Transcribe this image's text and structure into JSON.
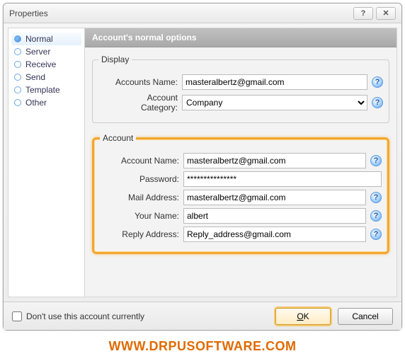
{
  "titlebar": {
    "title": "Properties",
    "help_label": "?",
    "close_label": "✕"
  },
  "sidebar": {
    "items": [
      {
        "label": "Normal"
      },
      {
        "label": "Server"
      },
      {
        "label": "Receive"
      },
      {
        "label": "Send"
      },
      {
        "label": "Template"
      },
      {
        "label": "Other"
      }
    ]
  },
  "main": {
    "header": "Account's normal options",
    "display": {
      "legend": "Display",
      "accounts_name_label": "Accounts Name:",
      "accounts_name_value": "masteralbertz@gmail.com",
      "account_category_label": "Account Category:",
      "account_category_value": "Company"
    },
    "account": {
      "legend": "Account",
      "account_name_label": "Account Name:",
      "account_name_value": "masteralbertz@gmail.com",
      "password_label": "Password:",
      "password_value": "***************",
      "mail_address_label": "Mail Address:",
      "mail_address_value": "masteralbertz@gmail.com",
      "your_name_label": "Your Name:",
      "your_name_value": "albert",
      "reply_address_label": "Reply Address:",
      "reply_address_value": "Reply_address@gmail.com"
    }
  },
  "footer": {
    "checkbox_label": "Don't use this account currently",
    "ok_label": "OK",
    "cancel_label": "Cancel"
  },
  "watermark": "WWW.DRPUSOFTWARE.COM",
  "help_glyph": "?"
}
